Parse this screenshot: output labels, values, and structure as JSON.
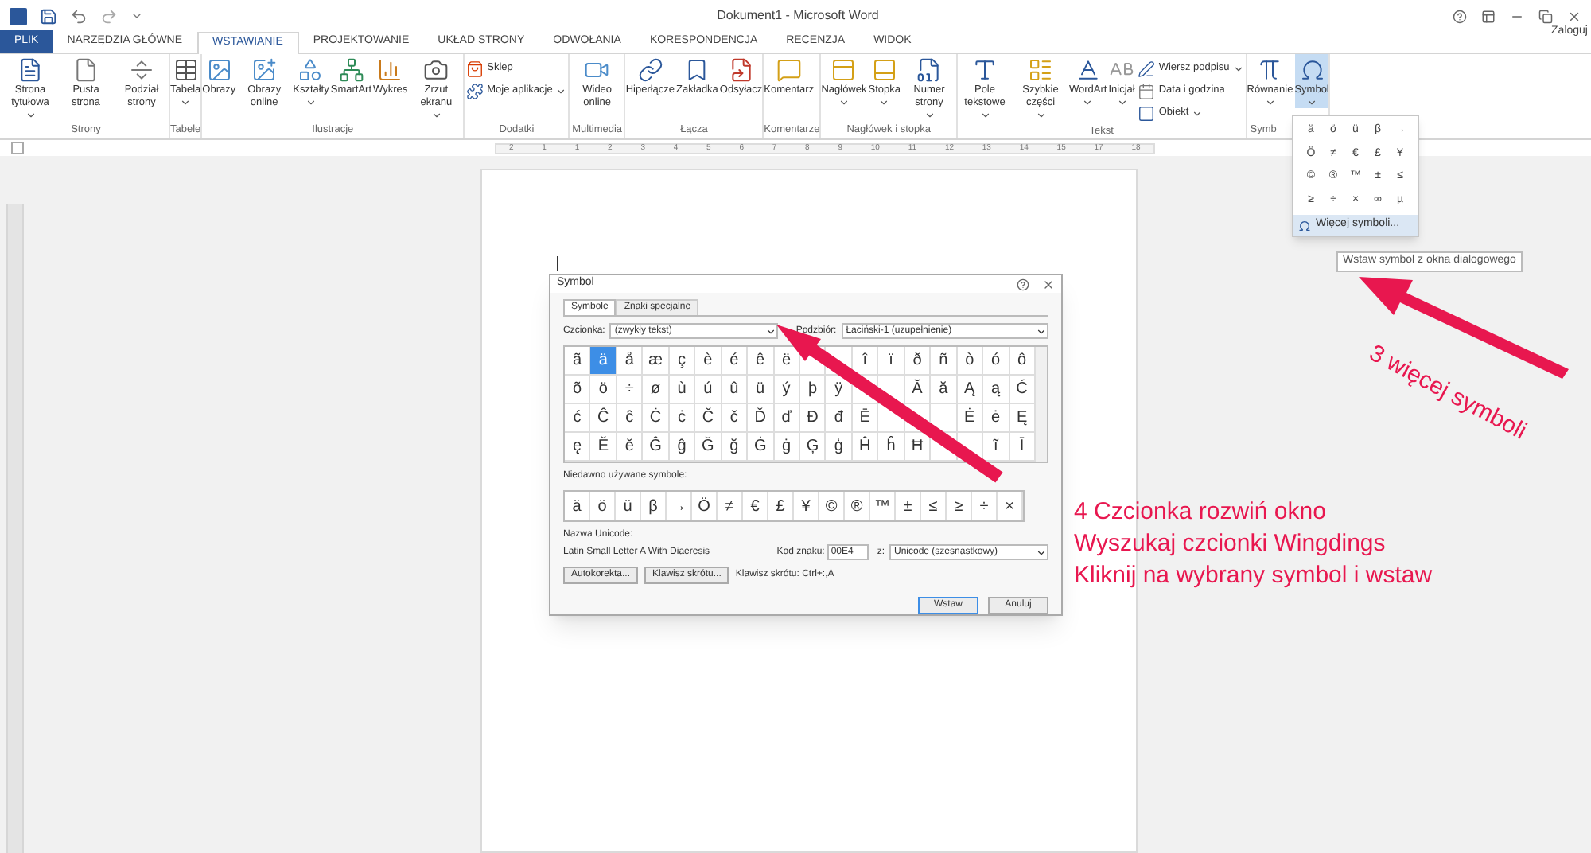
{
  "window": {
    "title": "Dokument1 - Microsoft Word",
    "sign_in": "Zaloguj"
  },
  "tabs": [
    {
      "label": "PLIK",
      "kind": "file",
      "selected": false
    },
    {
      "label": "NARZĘDZIA GŁÓWNE",
      "selected": false
    },
    {
      "label": "WSTAWIANIE",
      "selected": true
    },
    {
      "label": "PROJEKTOWANIE",
      "selected": false
    },
    {
      "label": "UKŁAD STRONY",
      "selected": false
    },
    {
      "label": "ODWOŁANIA",
      "selected": false
    },
    {
      "label": "KORESPONDENCJA",
      "selected": false
    },
    {
      "label": "RECENZJA",
      "selected": false
    },
    {
      "label": "WIDOK",
      "selected": false
    }
  ],
  "ribbon_groups": [
    {
      "label": "Strony",
      "buttons": [
        {
          "label": "Strona tytułowa",
          "kind": "page",
          "menu": true
        },
        {
          "label": "Pusta strona",
          "kind": "blank",
          "menu": false
        },
        {
          "label": "Podział strony",
          "kind": "break",
          "menu": false
        }
      ]
    },
    {
      "label": "Tabele",
      "buttons": [
        {
          "label": "Tabela",
          "kind": "table",
          "menu": true
        }
      ]
    },
    {
      "label": "Ilustracje",
      "buttons": [
        {
          "label": "Obrazy",
          "kind": "image",
          "menu": false
        },
        {
          "label": "Obrazy online",
          "kind": "online-image",
          "menu": false
        },
        {
          "label": "Kształty",
          "kind": "shapes",
          "menu": true
        },
        {
          "label": "SmartArt",
          "kind": "smartart",
          "menu": false
        },
        {
          "label": "Wykres",
          "kind": "chart",
          "menu": false
        },
        {
          "label": "Zrzut ekranu",
          "kind": "screenshot",
          "menu": true
        }
      ]
    },
    {
      "label": "Dodatki",
      "small": [
        {
          "label": "Sklep",
          "kind": "store",
          "menu": false
        },
        {
          "label": "Moje aplikacje",
          "kind": "apps",
          "menu": true
        }
      ]
    },
    {
      "label": "Multimedia",
      "buttons": [
        {
          "label": "Wideo online",
          "kind": "video",
          "menu": false
        }
      ]
    },
    {
      "label": "Łącza",
      "buttons": [
        {
          "label": "Hiperłącze",
          "kind": "link",
          "menu": false
        },
        {
          "label": "Zakładka",
          "kind": "bookmark",
          "menu": false
        },
        {
          "label": "Odsyłacz",
          "kind": "crossref",
          "menu": false
        }
      ]
    },
    {
      "label": "Komentarze",
      "buttons": [
        {
          "label": "Komentarz",
          "kind": "comment",
          "menu": false
        }
      ]
    },
    {
      "label": "Nagłówek i stopka",
      "buttons": [
        {
          "label": "Nagłówek",
          "kind": "header",
          "menu": true
        },
        {
          "label": "Stopka",
          "kind": "footer",
          "menu": true
        },
        {
          "label": "Numer strony",
          "kind": "pagenum",
          "menu": true
        }
      ]
    },
    {
      "label": "Tekst",
      "buttons": [
        {
          "label": "Pole tekstowe",
          "kind": "textbox",
          "menu": true
        },
        {
          "label": "Szybkie części",
          "kind": "quickparts",
          "menu": true
        },
        {
          "label": "WordArt",
          "kind": "wordart",
          "menu": true
        },
        {
          "label": "Inicjał",
          "kind": "dropcap",
          "menu": true
        }
      ],
      "small": [
        {
          "label": "Wiersz podpisu",
          "kind": "signature",
          "menu": true
        },
        {
          "label": "Data i godzina",
          "kind": "date",
          "menu": false
        },
        {
          "label": "Obiekt",
          "kind": "object",
          "menu": true
        }
      ]
    },
    {
      "label": "Symb",
      "buttons": [
        {
          "label": "Równanie",
          "kind": "equation",
          "menu": true,
          "selected": false
        },
        {
          "label": "Symbol",
          "kind": "symbol",
          "menu": true,
          "selected": true
        }
      ]
    }
  ],
  "ruler": [
    "2",
    "1",
    "1",
    "2",
    "3",
    "4",
    "5",
    "6",
    "7",
    "8",
    "9",
    "10",
    "11",
    "12",
    "13",
    "14",
    "15",
    "17",
    "18"
  ],
  "symbol_menu": {
    "symbols": [
      "ä",
      "ö",
      "ü",
      "β",
      "→",
      "Ö",
      "≠",
      "€",
      "£",
      "¥",
      "©",
      "®",
      "™",
      "±",
      "≤",
      "≥",
      "÷",
      "×",
      "∞",
      "µ"
    ],
    "more": "Więcej symboli..."
  },
  "tooltip": "Wstaw symbol z okna dialogowego",
  "dialog": {
    "title": "Symbol",
    "tabs": [
      {
        "label": "Symbole",
        "selected": true
      },
      {
        "label": "Znaki specjalne",
        "selected": false
      }
    ],
    "font_label": "Czcionka:",
    "font_value": "(zwykły tekst)",
    "subset_label": "Podzbiór:",
    "subset_value": "Łaciński-1 (uzupełnienie)",
    "grid": [
      [
        {
          "symbol": "ã",
          "selected": false
        },
        {
          "symbol": "ä",
          "selected": true
        },
        {
          "symbol": "å",
          "selected": false
        },
        {
          "symbol": "æ",
          "selected": false
        },
        {
          "symbol": "ç",
          "selected": false
        },
        {
          "symbol": "è",
          "selected": false
        },
        {
          "symbol": "é",
          "selected": false
        },
        {
          "symbol": "ê",
          "selected": false
        },
        {
          "symbol": "ë",
          "selected": false
        },
        {
          "kind": "covered",
          "selected": false
        },
        {
          "kind": "covered",
          "selected": false
        },
        {
          "symbol": "î",
          "selected": false
        },
        {
          "symbol": "ï",
          "selected": false
        },
        {
          "symbol": "ð",
          "selected": false
        },
        {
          "symbol": "ñ",
          "selected": false
        },
        {
          "symbol": "ò",
          "selected": false
        },
        {
          "symbol": "ó",
          "selected": false
        },
        {
          "symbol": "ô",
          "selected": false
        }
      ],
      [
        {
          "symbol": "õ",
          "selected": false
        },
        {
          "symbol": "ö",
          "selected": false
        },
        {
          "symbol": "÷",
          "selected": false
        },
        {
          "symbol": "ø",
          "selected": false
        },
        {
          "symbol": "ù",
          "selected": false
        },
        {
          "symbol": "ú",
          "selected": false
        },
        {
          "symbol": "û",
          "selected": false
        },
        {
          "symbol": "ü",
          "selected": false
        },
        {
          "symbol": "ý",
          "selected": false
        },
        {
          "symbol": "þ",
          "selected": false
        },
        {
          "symbol": "ÿ",
          "selected": false
        },
        {
          "kind": "covered",
          "selected": false
        },
        {
          "kind": "covered",
          "selected": false
        },
        {
          "symbol": "Ă",
          "selected": false
        },
        {
          "symbol": "ă",
          "selected": false
        },
        {
          "symbol": "Ą",
          "selected": false
        },
        {
          "symbol": "ą",
          "selected": false
        },
        {
          "symbol": "Ć",
          "selected": false
        }
      ],
      [
        {
          "symbol": "ć",
          "selected": false
        },
        {
          "symbol": "Ĉ",
          "selected": false
        },
        {
          "symbol": "ĉ",
          "selected": false
        },
        {
          "symbol": "Ċ",
          "selected": false
        },
        {
          "symbol": "ċ",
          "selected": false
        },
        {
          "symbol": "Č",
          "selected": false
        },
        {
          "symbol": "č",
          "selected": false
        },
        {
          "symbol": "Ď",
          "selected": false
        },
        {
          "symbol": "ď",
          "selected": false
        },
        {
          "symbol": "Đ",
          "selected": false
        },
        {
          "symbol": "đ",
          "selected": false
        },
        {
          "symbol": "Ē",
          "selected": false
        },
        {
          "kind": "covered",
          "selected": false
        },
        {
          "kind": "covered",
          "selected": false
        },
        {
          "kind": "covered",
          "selected": false
        },
        {
          "symbol": "Ė",
          "selected": false
        },
        {
          "symbol": "ė",
          "selected": false
        },
        {
          "symbol": "Ę",
          "selected": false
        }
      ],
      [
        {
          "symbol": "ę",
          "selected": false
        },
        {
          "symbol": "Ě",
          "selected": false
        },
        {
          "symbol": "ě",
          "selected": false
        },
        {
          "symbol": "Ĝ",
          "selected": false
        },
        {
          "symbol": "ĝ",
          "selected": false
        },
        {
          "symbol": "Ğ",
          "selected": false
        },
        {
          "symbol": "ğ",
          "selected": false
        },
        {
          "symbol": "Ġ",
          "selected": false
        },
        {
          "symbol": "ġ",
          "selected": false
        },
        {
          "symbol": "Ģ",
          "selected": false
        },
        {
          "symbol": "ģ",
          "selected": false
        },
        {
          "symbol": "Ĥ",
          "selected": false
        },
        {
          "symbol": "ĥ",
          "selected": false
        },
        {
          "symbol": "Ħ",
          "selected": false
        },
        {
          "kind": "covered",
          "selected": false
        },
        {
          "kind": "covered",
          "selected": false
        },
        {
          "symbol": "ĩ",
          "selected": false
        },
        {
          "symbol": "Ī",
          "selected": false
        }
      ]
    ],
    "recent_label": "Niedawno używane symbole:",
    "recent": [
      "ä",
      "ö",
      "ü",
      "β",
      "→",
      "Ö",
      "≠",
      "€",
      "£",
      "¥",
      "©",
      "®",
      "™",
      "±",
      "≤",
      "≥",
      "÷",
      "×"
    ],
    "unicode_label": "Nazwa Unicode:",
    "unicode_name": "Latin Small Letter A With Diaeresis",
    "code_label": "Kod znaku:",
    "code_value": "00E4",
    "from_label": "z:",
    "from_value": "Unicode (szesnastkowy)",
    "autocorrect": "Autokorekta...",
    "shortcut_button": "Klawisz skrótu...",
    "shortcut_text": "Klawisz skrótu: Ctrl+:,A",
    "insert": "Wstaw",
    "cancel": "Anuluj"
  },
  "annotations": {
    "step3": "3 więcej symboli",
    "step4": [
      "4 Czcionka rozwiń okno",
      "Wyszukaj czcionki Wingdings",
      "Kliknij na wybrany symbol i wstaw"
    ]
  }
}
